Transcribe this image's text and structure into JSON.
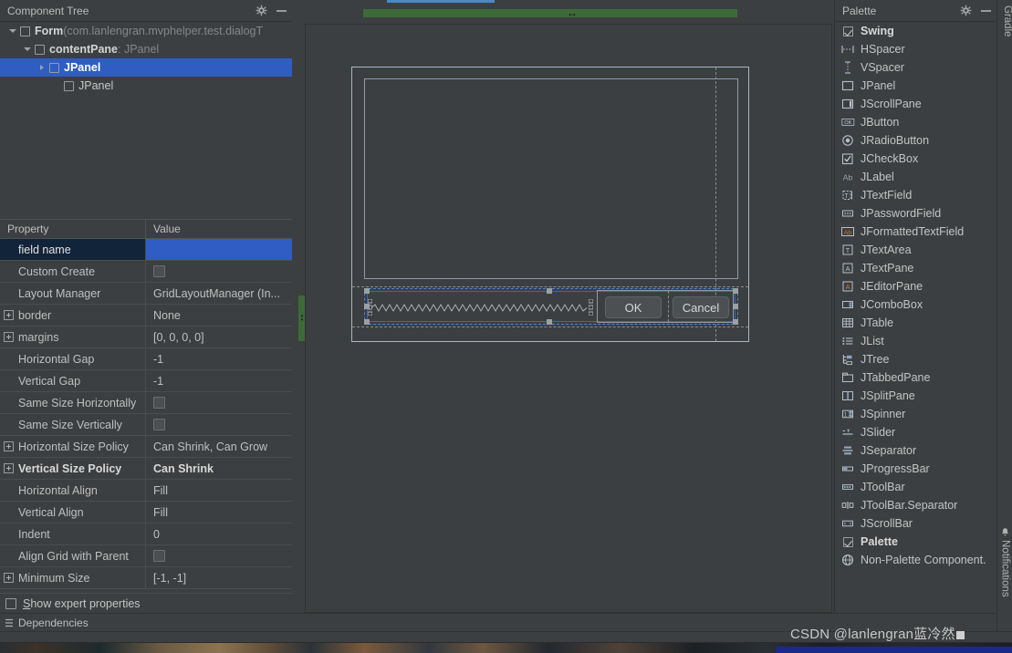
{
  "window": {
    "background": "#3c3f41",
    "accent_blue": "#2f5dc4",
    "tab_indicator_color": "#4a88c7",
    "splitter_green": "#3c6b38"
  },
  "component_tree": {
    "title": "Component Tree",
    "gear_icon": "gear-icon",
    "minimize_icon": "minimize-icon",
    "nodes": [
      {
        "indent": 0,
        "twisty": "open",
        "checkbox": true,
        "label": "Form",
        "suffix": " (com.lanlengran.mvphelper.test.dialogT",
        "bold": true,
        "selected": false
      },
      {
        "indent": 1,
        "twisty": "open",
        "checkbox": true,
        "label": "contentPane",
        "suffix": " : JPanel",
        "bold": true,
        "selected": false
      },
      {
        "indent": 2,
        "twisty": "closed",
        "checkbox": true,
        "label": "JPanel",
        "suffix": "",
        "bold": true,
        "selected": true
      },
      {
        "indent": 3,
        "twisty": "none",
        "checkbox": true,
        "label": "JPanel",
        "suffix": "",
        "bold": false,
        "selected": false
      }
    ]
  },
  "properties": {
    "headers": {
      "property": "Property",
      "value": "Value"
    },
    "rows": [
      {
        "name": "field name",
        "value": "",
        "expander": false,
        "selected": true,
        "bold": false,
        "value_type": "edit"
      },
      {
        "name": "Custom Create",
        "value": "",
        "expander": false,
        "selected": false,
        "bold": false,
        "value_type": "checkbox"
      },
      {
        "name": "Layout Manager",
        "value": "GridLayoutManager (In...",
        "expander": false,
        "selected": false,
        "bold": false,
        "value_type": "text"
      },
      {
        "name": "border",
        "value": "None",
        "expander": true,
        "selected": false,
        "bold": false,
        "value_type": "text"
      },
      {
        "name": "margins",
        "value": "[0, 0, 0, 0]",
        "expander": true,
        "selected": false,
        "bold": false,
        "value_type": "text"
      },
      {
        "name": "Horizontal Gap",
        "value": "-1",
        "expander": false,
        "selected": false,
        "bold": false,
        "value_type": "text"
      },
      {
        "name": "Vertical Gap",
        "value": "-1",
        "expander": false,
        "selected": false,
        "bold": false,
        "value_type": "text"
      },
      {
        "name": "Same Size Horizontally",
        "value": "",
        "expander": false,
        "selected": false,
        "bold": false,
        "value_type": "checkbox"
      },
      {
        "name": "Same Size Vertically",
        "value": "",
        "expander": false,
        "selected": false,
        "bold": false,
        "value_type": "checkbox"
      },
      {
        "name": "Horizontal Size Policy",
        "value": "Can Shrink, Can Grow",
        "expander": true,
        "selected": false,
        "bold": false,
        "value_type": "text"
      },
      {
        "name": "Vertical Size Policy",
        "value": "Can Shrink",
        "expander": true,
        "selected": false,
        "bold": true,
        "value_type": "text"
      },
      {
        "name": "Horizontal Align",
        "value": "Fill",
        "expander": false,
        "selected": false,
        "bold": false,
        "value_type": "text"
      },
      {
        "name": "Vertical Align",
        "value": "Fill",
        "expander": false,
        "selected": false,
        "bold": false,
        "value_type": "text"
      },
      {
        "name": "Indent",
        "value": "0",
        "expander": false,
        "selected": false,
        "bold": false,
        "value_type": "text"
      },
      {
        "name": "Align Grid with Parent",
        "value": "",
        "expander": false,
        "selected": false,
        "bold": false,
        "value_type": "checkbox"
      },
      {
        "name": "Minimum Size",
        "value": "[-1, -1]",
        "expander": true,
        "selected": false,
        "bold": false,
        "value_type": "text"
      }
    ],
    "expert": {
      "label_underlined": "S",
      "label_rest": "how expert properties",
      "checked": false
    }
  },
  "canvas": {
    "ok_button": "OK",
    "cancel_button": "Cancel"
  },
  "palette": {
    "title": "Palette",
    "gear_icon": "gear-icon",
    "minimize_icon": "minimize-icon",
    "items": [
      {
        "label": "Swing",
        "icon": "checkbox-checked-icon",
        "group": true
      },
      {
        "label": "HSpacer",
        "icon": "hspacer-icon",
        "group": false
      },
      {
        "label": "VSpacer",
        "icon": "vspacer-icon",
        "group": false
      },
      {
        "label": "JPanel",
        "icon": "panel-icon",
        "group": false
      },
      {
        "label": "JScrollPane",
        "icon": "scrollpane-icon",
        "group": false
      },
      {
        "label": "JButton",
        "icon": "button-icon",
        "group": false
      },
      {
        "label": "JRadioButton",
        "icon": "radio-icon",
        "group": false
      },
      {
        "label": "JCheckBox",
        "icon": "checkbox-icon",
        "group": false
      },
      {
        "label": "JLabel",
        "icon": "label-ab-icon",
        "group": false
      },
      {
        "label": "JTextField",
        "icon": "textfield-icon",
        "group": false
      },
      {
        "label": "JPasswordField",
        "icon": "passwordfield-icon",
        "group": false
      },
      {
        "label": "JFormattedTextField",
        "icon": "formatted-ab-icon",
        "group": false
      },
      {
        "label": "JTextArea",
        "icon": "textarea-t-icon",
        "group": false
      },
      {
        "label": "JTextPane",
        "icon": "textpane-a-icon",
        "group": false
      },
      {
        "label": "JEditorPane",
        "icon": "editorpane-a-icon",
        "group": false
      },
      {
        "label": "JComboBox",
        "icon": "combobox-icon",
        "group": false
      },
      {
        "label": "JTable",
        "icon": "table-icon",
        "group": false
      },
      {
        "label": "JList",
        "icon": "list-icon",
        "group": false
      },
      {
        "label": "JTree",
        "icon": "tree-icon",
        "group": false
      },
      {
        "label": "JTabbedPane",
        "icon": "tabbedpane-icon",
        "group": false
      },
      {
        "label": "JSplitPane",
        "icon": "splitpane-icon",
        "group": false
      },
      {
        "label": "JSpinner",
        "icon": "spinner-icon",
        "group": false
      },
      {
        "label": "JSlider",
        "icon": "slider-icon",
        "group": false
      },
      {
        "label": "JSeparator",
        "icon": "separator-icon",
        "group": false
      },
      {
        "label": "JProgressBar",
        "icon": "progressbar-icon",
        "group": false
      },
      {
        "label": "JToolBar",
        "icon": "toolbar-icon",
        "group": false
      },
      {
        "label": "JToolBar.Separator",
        "icon": "toolbar-separator-icon",
        "group": false
      },
      {
        "label": "JScrollBar",
        "icon": "scrollbar-icon",
        "group": false
      },
      {
        "label": "Palette",
        "icon": "checkbox-checked-icon",
        "group": true
      },
      {
        "label": "Non-Palette Component.",
        "icon": "globe-icon",
        "group": false
      }
    ]
  },
  "right_strip": {
    "gradle": "Gradle",
    "notifications": "Notifications"
  },
  "bottom": {
    "dependencies": "Dependencies"
  },
  "watermark": {
    "text": "CSDN @lanlengran蓝冷然"
  }
}
